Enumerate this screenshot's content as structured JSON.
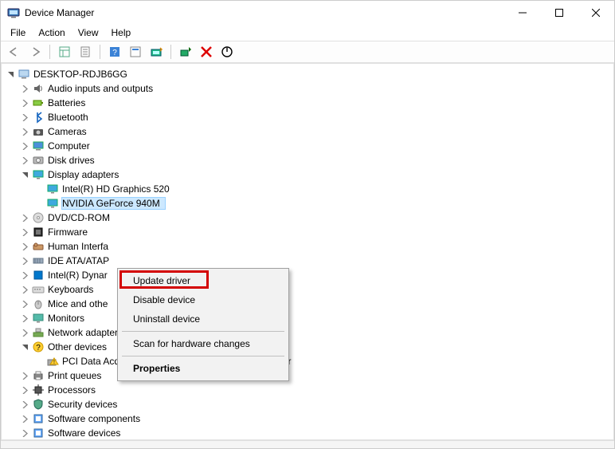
{
  "window": {
    "title": "Device Manager"
  },
  "menubar": [
    "File",
    "Action",
    "View",
    "Help"
  ],
  "toolbar": {
    "back": "◄",
    "forward": "►"
  },
  "tree": {
    "root": "DESKTOP-RDJB6GG",
    "categories": [
      {
        "label": "Audio inputs and outputs",
        "icon": "speaker"
      },
      {
        "label": "Batteries",
        "icon": "battery"
      },
      {
        "label": "Bluetooth",
        "icon": "bluetooth"
      },
      {
        "label": "Cameras",
        "icon": "camera"
      },
      {
        "label": "Computer",
        "icon": "computer"
      },
      {
        "label": "Disk drives",
        "icon": "disk"
      },
      {
        "label": "Display adapters",
        "icon": "display",
        "expanded": true,
        "children": [
          {
            "label": "Intel(R) HD Graphics 520",
            "icon": "display"
          },
          {
            "label": "NVIDIA GeForce 940M",
            "icon": "display",
            "selected": true
          }
        ]
      },
      {
        "label": "DVD/CD-ROM",
        "icon": "dvd",
        "truncated": true
      },
      {
        "label": "Firmware",
        "icon": "firmware"
      },
      {
        "label": "Human Interfa",
        "icon": "hid",
        "truncated": true
      },
      {
        "label": "IDE ATA/ATAP",
        "icon": "ide",
        "truncated": true
      },
      {
        "label": "Intel(R) Dynar",
        "icon": "intel",
        "truncated": true
      },
      {
        "label": "Keyboards",
        "icon": "keyboard"
      },
      {
        "label": "Mice and othe",
        "icon": "mouse",
        "truncated": true
      },
      {
        "label": "Monitors",
        "icon": "monitor"
      },
      {
        "label": "Network adapters",
        "icon": "network"
      },
      {
        "label": "Other devices",
        "icon": "other",
        "expanded": true,
        "children": [
          {
            "label": "PCI Data Acquisition and Signal Processing Controller",
            "icon": "warn"
          }
        ]
      },
      {
        "label": "Print queues",
        "icon": "printer"
      },
      {
        "label": "Processors",
        "icon": "cpu"
      },
      {
        "label": "Security devices",
        "icon": "security"
      },
      {
        "label": "Software components",
        "icon": "software"
      },
      {
        "label": "Software devices",
        "icon": "software",
        "truncated": true
      }
    ]
  },
  "context_menu": {
    "items": [
      {
        "label": "Update driver",
        "key": "update"
      },
      {
        "label": "Disable device",
        "key": "disable"
      },
      {
        "label": "Uninstall device",
        "key": "uninstall"
      },
      {
        "sep": true
      },
      {
        "label": "Scan for hardware changes",
        "key": "scan"
      },
      {
        "sep": true
      },
      {
        "label": "Properties",
        "key": "props",
        "bold": true
      }
    ]
  }
}
